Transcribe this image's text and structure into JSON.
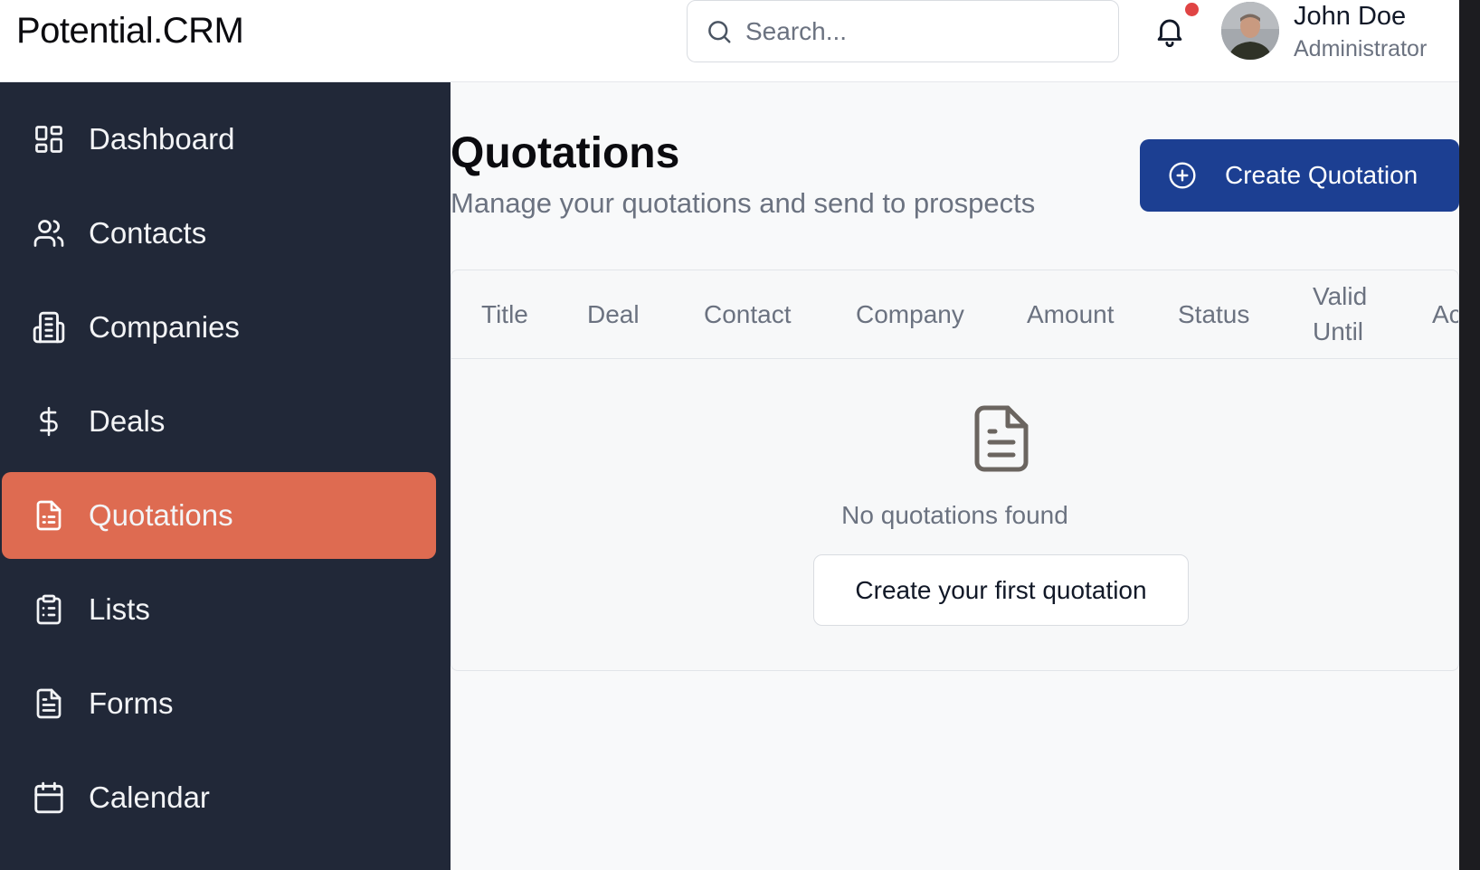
{
  "header": {
    "brand": "Potential.CRM",
    "search_placeholder": "Search...",
    "user": {
      "name": "John Doe",
      "role": "Administrator"
    },
    "notification_dot_color": "#e04444"
  },
  "sidebar": {
    "items": [
      {
        "label": "Dashboard",
        "icon": "dashboard-icon",
        "active": false
      },
      {
        "label": "Contacts",
        "icon": "users-icon",
        "active": false
      },
      {
        "label": "Companies",
        "icon": "building-icon",
        "active": false
      },
      {
        "label": "Deals",
        "icon": "dollar-icon",
        "active": false
      },
      {
        "label": "Quotations",
        "icon": "document-icon",
        "active": true
      },
      {
        "label": "Lists",
        "icon": "clipboard-list-icon",
        "active": false
      },
      {
        "label": "Forms",
        "icon": "file-text-icon",
        "active": false
      },
      {
        "label": "Calendar",
        "icon": "calendar-icon",
        "active": false
      }
    ],
    "background": "#212838",
    "active_color": "#de6b51"
  },
  "main": {
    "title": "Quotations",
    "subtitle": "Manage your quotations and send to prospects",
    "create_button": "Create Quotation",
    "create_button_color": "#1c3f92",
    "table": {
      "columns": [
        "Title",
        "Deal",
        "Contact",
        "Company",
        "Amount",
        "Status",
        "Valid",
        "Until",
        "Ac"
      ],
      "empty_text": "No quotations found",
      "empty_action": "Create your first quotation"
    }
  }
}
